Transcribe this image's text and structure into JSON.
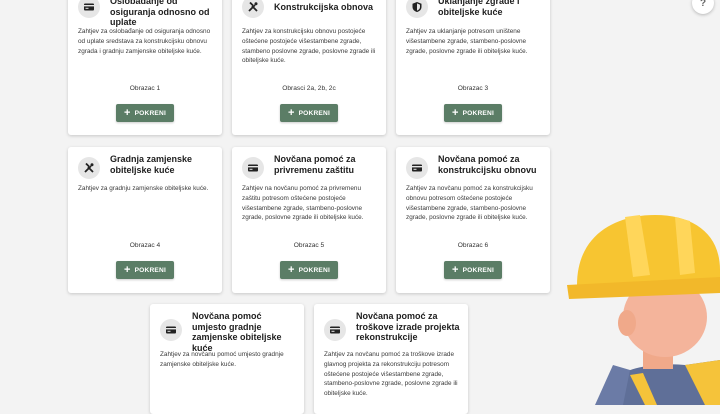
{
  "help": {
    "icon": "help-icon",
    "glyph": "?"
  },
  "button_label": "POKRENI",
  "cards": [
    {
      "title": "Oslobađanje od osiguranja odnosno od uplate",
      "icon": "credit-card-icon",
      "description": "Zahtjev za oslobađanje od osiguranja odnosno od uplate sredstava za konstrukcijsku obnovu zgrada i gradnju zamjenske obiteljske kuće.",
      "form": "Obrazac 1"
    },
    {
      "title": "Konstrukcijska obnova",
      "icon": "tools-icon",
      "description": "Zahtjev za konstrukcijsku obnovu postojeće oštećene postojeće višestambene zgrade, stambeno poslovne zgrade, poslovne zgrade ili obiteljske kuće.",
      "form": "Obrasci 2a, 2b, 2c"
    },
    {
      "title": "Uklanjanje zgrade i obiteljske kuće",
      "icon": "shield-icon",
      "description": "Zahtjev za uklanjanje potresom uništene višestambene zgrade, stambeno-poslovne zgrade, poslovne zgrade ili obiteljske kuće.",
      "form": "Obrazac 3"
    },
    {
      "title": "Gradnja zamjenske obiteljske kuće",
      "icon": "tools-icon",
      "description": "Zahtjev za gradnju zamjenske obiteljske kuće.",
      "form": "Obrazac 4"
    },
    {
      "title": "Novčana pomoć za privremenu zaštitu",
      "icon": "credit-card-icon",
      "description": "Zahtjev na novčanu pomoć za privremenu zaštitu potresom oštećene postojeće višestambene zgrade, stambeno-poslovne zgrade, poslovne zgrade ili obiteljske kuće.",
      "form": "Obrazac 5"
    },
    {
      "title": "Novčana pomoć za konstrukcijsku obnovu",
      "icon": "credit-card-icon",
      "description": "Zahtjev za novčanu pomoć za konstrukcijsku obnovu potresom oštećene postojeće višestambene zgrade, stambeno-poslovne zgrade, poslovne zgrade ili obiteljske kuće.",
      "form": "Obrazac 6"
    },
    {
      "title": "Novčana pomoć umjesto gradnje zamjenske obiteljske kuće",
      "icon": "credit-card-icon",
      "description": "Zahtjev za novčanu pomoć umjesto gradnje zamjenske obiteljske kuće."
    },
    {
      "title": "Novčana pomoć za troškove izrade projekta rekonstrukcije",
      "icon": "credit-card-icon",
      "description": "Zahtjev za novčanu pomoć za troškove izrade glavnog projekta za rekonstrukciju potresom oštećene postojeće višestambene zgrade, stambeno-poslovne zgrade, poslovne zgrade ili obiteljske kuće."
    }
  ],
  "colors": {
    "button": "#5b7d66",
    "page_background": "#f3f3f3",
    "helmet": "#f7c531"
  }
}
